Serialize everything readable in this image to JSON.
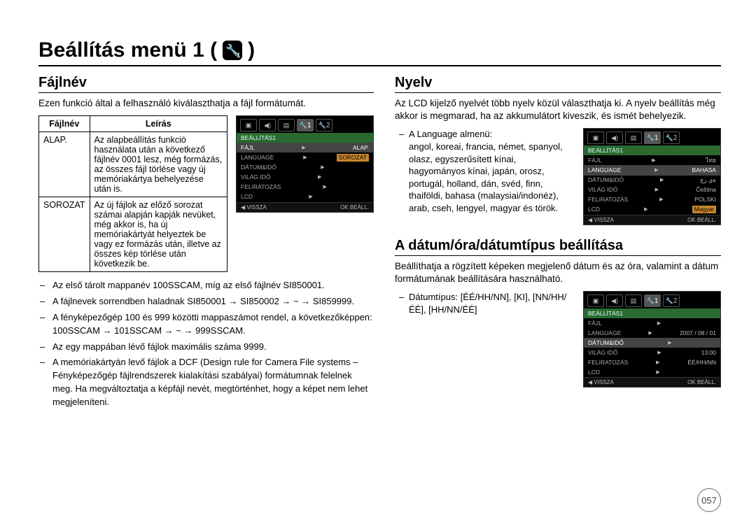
{
  "page_title": "Beállítás menü 1 (",
  "page_title_suffix": ")",
  "icon_sub": "1",
  "page_number": "057",
  "left": {
    "title": "Fájlnév",
    "intro": "Ezen funkció által a felhasználó kiválaszthatja a fájl formátumát.",
    "table": {
      "headers": [
        "Fájlnév",
        "Leírás"
      ],
      "rows": [
        {
          "name": "ALAP.",
          "desc": "Az alapbeállítás funkció használata után a következő fájlnév 0001 lesz, még formázás, az összes fájl törlése vagy új memóriakártya behelyezése után is."
        },
        {
          "name": "SOROZAT",
          "desc": "Az új fájlok az előző sorozat számai alapján kapják nevüket, még akkor is, ha új memóriakártyát helyeztek be vagy ez formázás után, illetve az összes kép törlése után következik be."
        }
      ]
    },
    "bullets": [
      "Az első tárolt mappanév 100SSCAM, míg az első fájlnév SI850001.",
      "A fájlnevek sorrendben haladnak SI850001 → SI850002 → ~ → SI859999.",
      "A fényképezőgép 100 és 999 közötti mappaszámot rendel, a következőképpen: 100SSCAM → 101SSCAM → ~ → 999SSCAM.",
      "Az egy mappában lévő fájlok maximális száma 9999.",
      "A memóriakártyán levő fájlok a DCF (Design rule for Camera File systems – Fényképezőgép fájlrendszerek kialakítási szabályai) formátumnak felelnek meg. Ha megváltoztatja a képfájl nevét, megtörténhet, hogy a képet nem lehet megjeleníteni."
    ],
    "lcd": {
      "header": "BEÁLLÍTÁS1",
      "rows": [
        {
          "label": "FÁJL",
          "value": "ALAP.",
          "sel": true,
          "selval": false
        },
        {
          "label": "LANGUAGE",
          "value": "SOROZAT",
          "sel": false,
          "selval": true
        },
        {
          "label": "DÁTUM&IDŐ",
          "value": "",
          "sel": false
        },
        {
          "label": "VILÁG IDŐ",
          "value": "",
          "sel": false
        },
        {
          "label": "FELIRATOZÁS",
          "value": "",
          "sel": false
        },
        {
          "label": "LCD",
          "value": "",
          "sel": false
        }
      ],
      "footer_left": "◀  VISSZA",
      "footer_right": "OK  BEÁLL."
    }
  },
  "right": {
    "nyelv": {
      "title": "Nyelv",
      "intro": "Az LCD kijelző nyelvét több nyelv közül választhatja ki. A nyelv beállítás még akkor is megmarad, ha az akkumulátort kiveszik, és ismét behelyezik.",
      "submenu_head": "A Language almenü:",
      "submenu_body": "angol, koreai, francia, német, spanyol, olasz, egyszerűsített kínai, hagyományos kínai, japán, orosz, portugál, holland, dán, svéd, finn, thaiföldi, bahasa (malaysiai/indonéz), arab, cseh, lengyel, magyar és török.",
      "lcd": {
        "header": "BEÁLLÍTÁS1",
        "rows": [
          {
            "label": "FÁJL",
            "value": "ไทย",
            "sel": false
          },
          {
            "label": "LANGUAGE",
            "value": "BAHASA",
            "sel": true
          },
          {
            "label": "DÁTUM&IDŐ",
            "value": "ةي رع",
            "sel": false
          },
          {
            "label": "VILÁG IDŐ",
            "value": "Čeština",
            "sel": false
          },
          {
            "label": "FELIRATOZÁS",
            "value": "POLSKI",
            "sel": false
          },
          {
            "label": "LCD",
            "value": "Magyar",
            "sel": false,
            "selval": true
          }
        ],
        "footer_left": "◀  VISSZA",
        "footer_right": "OK  BEÁLL."
      }
    },
    "datum": {
      "title": "A dátum/óra/dátumtípus beállítása",
      "intro": "Beállíthatja a rögzített képeken megjelenő dátum és az óra, valamint a dátum formátumának beállítására használható.",
      "bullet": "Dátumtípus: [ÉÉ/HH/NN], [KI], [NN/HH/ÉÉ], [HH/NN/ÉÉ]",
      "lcd": {
        "header": "BEÁLLÍTÁS1",
        "rows": [
          {
            "label": "FÁJL",
            "value": "",
            "sel": false
          },
          {
            "label": "LANGUAGE",
            "value": "2007 / 08 / 01",
            "sel": false
          },
          {
            "label": "DÁTUM&IDŐ",
            "value": "",
            "sel": true
          },
          {
            "label": "VILÁG IDŐ",
            "value": "13:00",
            "sel": false
          },
          {
            "label": "FELIRATOZÁS",
            "value": "ÉÉ/HH/NN",
            "sel": false
          },
          {
            "label": "LCD",
            "value": "",
            "sel": false
          }
        ],
        "footer_left": "◀  VISSZA",
        "footer_right": "OK  BEÁLL."
      }
    }
  },
  "icons": {
    "camera": "◻",
    "speaker": "🔊",
    "wrench": "🔧"
  }
}
